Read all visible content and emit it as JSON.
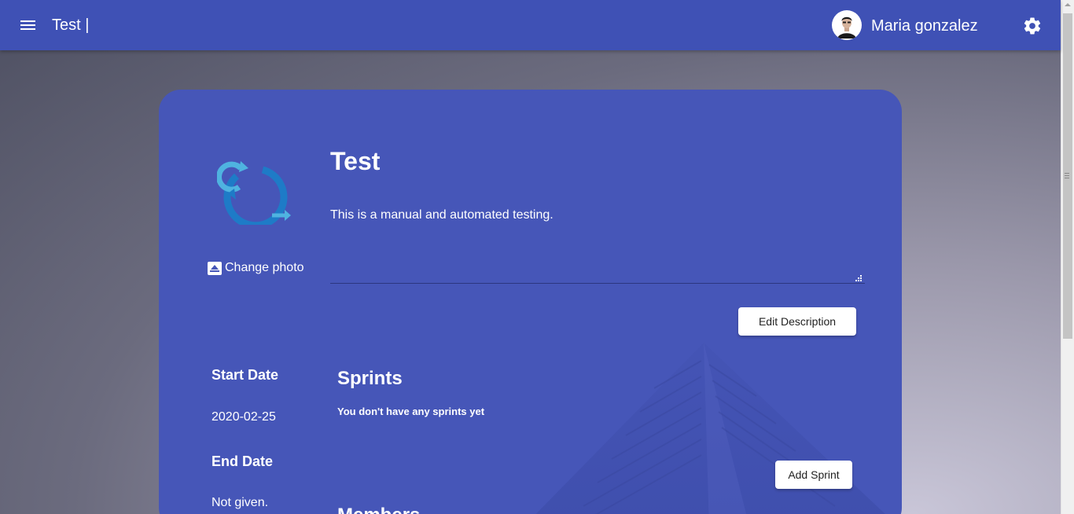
{
  "header": {
    "title": "Test |",
    "user_name": "Maria gonzalez",
    "menu_icon": "hamburger-menu-icon",
    "settings_icon": "gear-icon",
    "color": "#3f51b5"
  },
  "project": {
    "title": "Test",
    "description": "This is a manual and automated testing.",
    "change_photo_label": "Change photo",
    "edit_description_label": "Edit Description"
  },
  "dates": {
    "start_label": "Start Date",
    "start_value": "2020-02-25",
    "end_label": "End Date",
    "end_value": "Not given."
  },
  "sprints": {
    "heading": "Sprints",
    "empty_text": "You don't have any sprints yet",
    "add_label": "Add Sprint"
  },
  "members": {
    "heading": "Members"
  },
  "colors": {
    "card": "#4656b8",
    "logo_light": "#4fb3e0",
    "logo_dark": "#1e7bc7"
  }
}
